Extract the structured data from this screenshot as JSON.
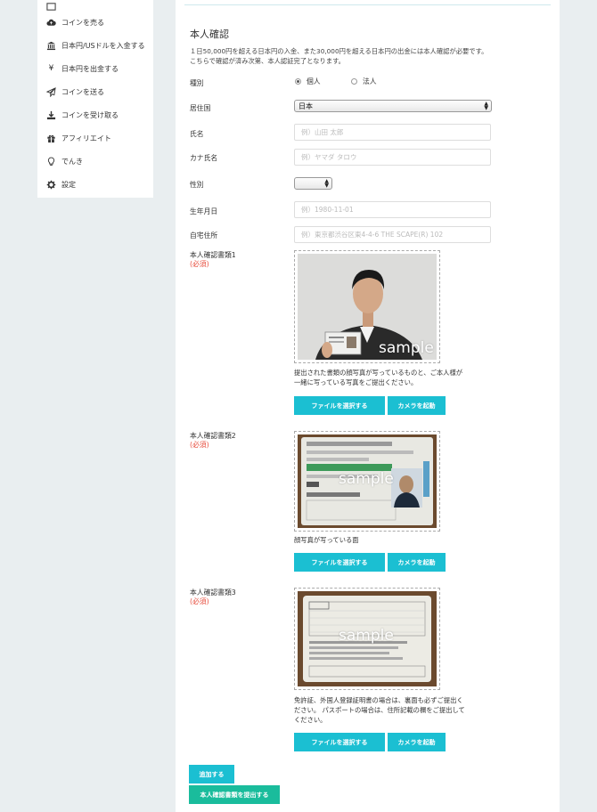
{
  "sidebar": {
    "items": [
      {
        "label": "コインを売る",
        "icon": "cloud-upload-icon"
      },
      {
        "label": "日本円/USドルを入金する",
        "icon": "bank-icon"
      },
      {
        "label": "日本円を出金する",
        "icon": "yen-icon"
      },
      {
        "label": "コインを送る",
        "icon": "send-icon"
      },
      {
        "label": "コインを受け取る",
        "icon": "download-icon"
      },
      {
        "label": "アフィリエイト",
        "icon": "gift-icon"
      },
      {
        "label": "でんき",
        "icon": "lightbulb-icon"
      },
      {
        "label": "設定",
        "icon": "gear-icon"
      }
    ]
  },
  "form": {
    "title": "本人確認",
    "description_line1": "１日50,000円を超える日本円の入金、また30,000円を超える日本円の出金には本人確認が必要です。",
    "description_line2": "こちらで確認が済み次第、本人認証完了となります。",
    "type_label": "種別",
    "type_option_individual": "個人",
    "type_option_corporate": "法人",
    "country_label": "居住国",
    "country_value": "日本",
    "name_label": "氏名",
    "name_placeholder": "例）山田 太郎",
    "kana_label": "カナ氏名",
    "kana_placeholder": "例）ヤマダ タロウ",
    "gender_label": "性別",
    "gender_value": "",
    "birthday_label": "生年月日",
    "birthday_placeholder": "例）1980-11-01",
    "address_label": "自宅住所",
    "address_placeholder": "例）東京都渋谷区東4-4-6 THE SCAPE(R) 102",
    "required_text": "(必須)",
    "sample_text": "sample",
    "doc1": {
      "label": "本人確認書類1",
      "note_line1": "提出された書類の顔写真が写っているものと、ご本人様が",
      "note_line2": "一緒に写っている写真をご提出ください。"
    },
    "doc2": {
      "label": "本人確認書類2",
      "note_line1": "顔写真が写っている面"
    },
    "doc3": {
      "label": "本人確認書類3",
      "note_line1": "免許証、外国人登録証明書の場合は、裏面も必ずご提出く",
      "note_line2": "ださい。 パスポートの場合は、住所記載の欄をご提出して",
      "note_line3": "ください。"
    },
    "file_button": "ファイルを選択する",
    "camera_button": "カメラを起動",
    "add_button": "追加する",
    "submit_button": "本人確認書類を提出する"
  },
  "colors": {
    "accent": "#1bbfd2",
    "submit": "#1abc9c",
    "required": "#e74c3c",
    "background": "#e9eef0"
  }
}
